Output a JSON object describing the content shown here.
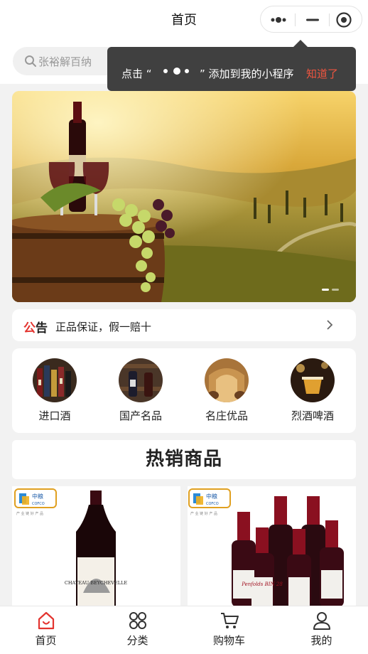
{
  "header": {
    "title": "首页"
  },
  "search": {
    "placeholder": "张裕解百纳"
  },
  "tooltip": {
    "prefix": "点击 “",
    "suffix": "” 添加到我的小程序",
    "dismiss": "知道了"
  },
  "banner": {
    "slide_count": 2,
    "active_slide": 1
  },
  "notice": {
    "label_accent": "公",
    "label_rest": "告",
    "text": "正品保证，假一赔十"
  },
  "categories": [
    {
      "label": "进口酒"
    },
    {
      "label": "国产名品"
    },
    {
      "label": "名庄优品"
    },
    {
      "label": "烈酒啤酒"
    }
  ],
  "section": {
    "hot_title": "热销商品"
  },
  "products": [
    {
      "brand_badge": "中粮",
      "bottle_label": "CHATEAU BEYCHEVELLE"
    },
    {
      "brand_badge": "中粮",
      "bottle_label": "Penfolds BIN 28"
    }
  ],
  "tabbar": {
    "items": [
      {
        "label": "首页",
        "icon": "home-icon",
        "active": true
      },
      {
        "label": "分类",
        "icon": "category-icon",
        "active": false
      },
      {
        "label": "购物车",
        "icon": "cart-icon",
        "active": false
      },
      {
        "label": "我的",
        "icon": "user-icon",
        "active": false
      }
    ]
  },
  "colors": {
    "accent": "#e3342f",
    "tooltip_bg": "#404040",
    "tooltip_action": "#f0553f"
  }
}
